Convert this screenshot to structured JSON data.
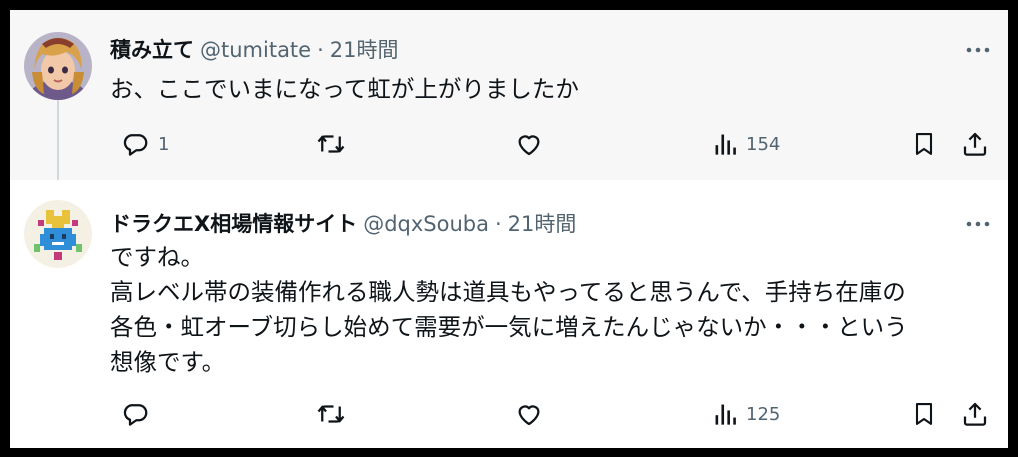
{
  "tweets": [
    {
      "display_name": "積み立て",
      "handle": "@tumitate",
      "separator": "·",
      "time": "21時間",
      "avatar_icon": "anime-character-avatar",
      "more_icon": "more-horizontal-icon",
      "lines": [
        "お、ここでいまになって虹が上がりましたか"
      ],
      "reply_count": "1",
      "retweet_count": "",
      "like_count": "",
      "views_count": "154"
    },
    {
      "display_name": "ドラクエX相場情報サイト",
      "handle": "@dqxSouba",
      "separator": "·",
      "time": "21時間",
      "avatar_icon": "pixel-art-slime-avatar",
      "more_icon": "more-horizontal-icon",
      "lines": [
        "ですね。",
        "高レベル帯の装備作れる職人勢は道具もやってると思うんで、手持ち在庫の",
        "各色・虹オーブ切らし始めて需要が一気に増えたんじゃないか・・・という",
        "想像です。"
      ],
      "reply_count": "",
      "retweet_count": "",
      "like_count": "",
      "views_count": "125"
    }
  ],
  "colors": {
    "text_primary": "#0f1419",
    "text_secondary": "#536471",
    "thread_line": "#cfd9de",
    "first_tweet_bg": "#f7f7f7",
    "outer_frame": "#000000"
  }
}
